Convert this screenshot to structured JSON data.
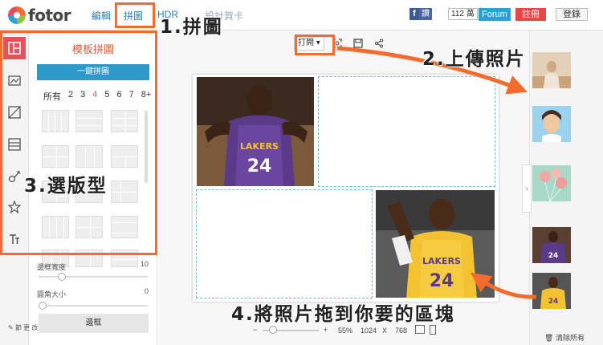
{
  "app": {
    "brand": "fotor",
    "nav": [
      "編輯",
      "拼圖",
      "HDR"
    ],
    "nav_hidden_tail": "設計賀卡",
    "fb_like": "讚",
    "fb_count": "112 萬",
    "forum": "Forum",
    "register": "註冊",
    "login": "登錄"
  },
  "rail": {
    "icons": [
      "template-icon",
      "freestyle-collage-icon",
      "photo-stitching-icon",
      "layout-icon",
      "decoration-icon",
      "sticker-icon",
      "text-icon"
    ]
  },
  "panel": {
    "title": "模板拼圖",
    "auto_button": "一鍵拼圖",
    "counts": [
      "所有",
      "2",
      "3",
      "4",
      "5",
      "6",
      "7",
      "8+"
    ],
    "selected_count": "4",
    "border_width_label": "邊框寬度",
    "border_width_value": "10",
    "corner_label": "圓角大小",
    "corner_value": "0",
    "border_button": "邊框",
    "footer_text": "節 更 改"
  },
  "toolbar": {
    "print_label": "打開",
    "print_dropdown": "▾"
  },
  "zoom": {
    "minus": "−",
    "plus": "+",
    "percent": "55%",
    "width": "1024",
    "times": "X",
    "height": "768"
  },
  "strip": {
    "clear_all": "清除所有",
    "expand": "›"
  },
  "annotations": {
    "step1": "1.拼圖",
    "step2": "2.上傳照片",
    "step3": "3.選版型",
    "step4": "4.將照片拖到你要的區塊"
  },
  "colors": {
    "accent_orange": "#f36b2d",
    "brand_red": "#e8505b",
    "link_blue": "#2a7fc1",
    "button_blue": "#2b99c9",
    "dashed_cell": "#6bb7dd"
  }
}
